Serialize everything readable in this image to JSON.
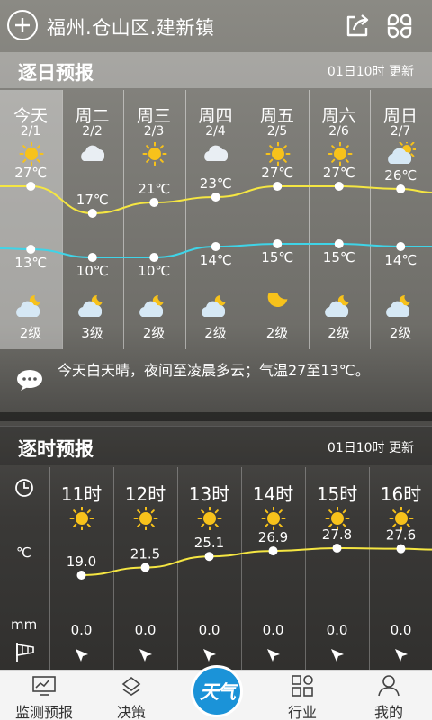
{
  "header": {
    "location": "福州.仓山区.建新镇",
    "icons": [
      "add-icon",
      "share-icon",
      "grid-icon"
    ]
  },
  "daily": {
    "title": "逐日预报",
    "update": "01日10时 更新",
    "days": [
      {
        "name": "今天",
        "date": "2/1",
        "day_icon": "sun",
        "high": "27℃",
        "low": "13℃",
        "night_icon": "cloud-moon",
        "wind": "2级"
      },
      {
        "name": "周二",
        "date": "2/2",
        "day_icon": "cloud",
        "high": "17℃",
        "low": "10℃",
        "night_icon": "cloud-moon",
        "wind": "3级"
      },
      {
        "name": "周三",
        "date": "2/3",
        "day_icon": "sun",
        "high": "21℃",
        "low": "10℃",
        "night_icon": "cloud-moon",
        "wind": "2级"
      },
      {
        "name": "周四",
        "date": "2/4",
        "day_icon": "cloud",
        "high": "23℃",
        "low": "14℃",
        "night_icon": "cloud-moon",
        "wind": "2级"
      },
      {
        "name": "周五",
        "date": "2/5",
        "day_icon": "sun",
        "high": "27℃",
        "low": "15℃",
        "night_icon": "moon",
        "wind": "2级"
      },
      {
        "name": "周六",
        "date": "2/6",
        "day_icon": "sun",
        "high": "27℃",
        "low": "15℃",
        "night_icon": "cloud-moon",
        "wind": "2级"
      },
      {
        "name": "周日",
        "date": "2/7",
        "day_icon": "cloud-sun",
        "high": "26℃",
        "low": "14℃",
        "night_icon": "cloud-moon",
        "wind": "2级"
      }
    ],
    "high_values": [
      27,
      17,
      21,
      23,
      27,
      27,
      26
    ],
    "low_values": [
      13,
      10,
      10,
      14,
      15,
      15,
      14
    ],
    "summary": "今天白天晴，夜间至凌晨多云；气温27至13℃。"
  },
  "hourly": {
    "title": "逐时预报",
    "update": "01日10时 更新",
    "celsius_label": "℃",
    "rain_label": "mm",
    "hours": [
      {
        "time": "11时",
        "icon": "sun",
        "temp": "19.0",
        "rain": "0.0"
      },
      {
        "time": "12时",
        "icon": "sun",
        "temp": "21.5",
        "rain": "0.0"
      },
      {
        "time": "13时",
        "icon": "sun",
        "temp": "25.1",
        "rain": "0.0"
      },
      {
        "time": "14时",
        "icon": "sun",
        "temp": "26.9",
        "rain": "0.0"
      },
      {
        "time": "15时",
        "icon": "sun",
        "temp": "27.8",
        "rain": "0.0"
      },
      {
        "time": "16时",
        "icon": "sun",
        "temp": "27.6",
        "rain": "0.0"
      }
    ],
    "temp_values": [
      19.0,
      21.5,
      25.1,
      26.9,
      27.8,
      27.6
    ]
  },
  "nav": {
    "items": [
      {
        "label": "监测预报",
        "icon": "monitor-icon"
      },
      {
        "label": "决策",
        "icon": "decision-icon"
      },
      {
        "label": "天气",
        "icon": "weather-icon"
      },
      {
        "label": "行业",
        "icon": "industry-icon"
      },
      {
        "label": "我的",
        "icon": "profile-icon"
      }
    ]
  },
  "colors": {
    "high_line": "#f5e642",
    "low_line": "#3fd4e8",
    "sun": "#f7c21b",
    "accent": "#1b93d8"
  }
}
